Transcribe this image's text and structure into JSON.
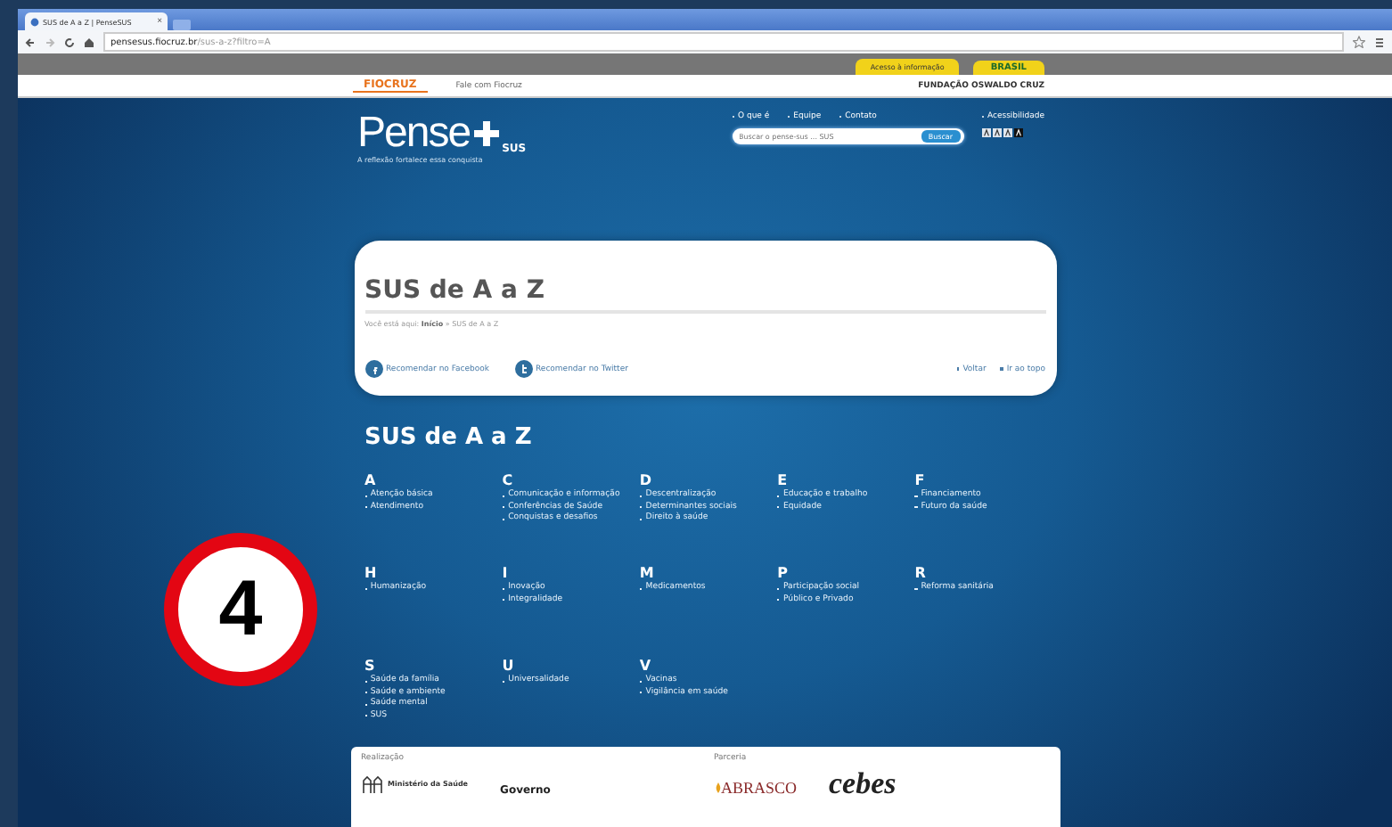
{
  "browser": {
    "tab_title": "SUS de A a Z | PenseSUS",
    "tab_close": "×",
    "url_host": "pensesus.fiocruz.br",
    "url_path": "/sus-a-z?filtro=A"
  },
  "gov_bar": {
    "links": [
      "Acesso à informação",
      "BRASIL"
    ]
  },
  "fiocruz_bar": {
    "logo": "FIOCRUZ",
    "link": "Fale com Fiocruz",
    "institution": "FUNDAÇÃO OSWALDO CRUZ"
  },
  "header": {
    "logo": "Pense",
    "logo_sub": "SUS",
    "tagline": "A reflexão fortalece essa conquista",
    "nav": [
      "O que é",
      "Equipe",
      "Contato"
    ],
    "search": {
      "placeholder": "Buscar o pense-sus ... SUS",
      "button": "Buscar"
    },
    "accessibility": "Acessibilidade"
  },
  "card": {
    "title": "SUS de A a Z",
    "breadcrumb": {
      "prefix": "Você está aqui:",
      "home": "Início",
      "current": "» SUS de A a Z"
    },
    "share": [
      {
        "kind": "facebook",
        "label": "Recomendar no Facebook"
      },
      {
        "kind": "twitter",
        "label": "Recomendar no Twitter"
      }
    ],
    "links": [
      "Voltar",
      "Ir ao topo"
    ]
  },
  "index": {
    "title": "SUS de A a Z",
    "groups": [
      {
        "letter": "A",
        "items": [
          "Atenção básica",
          "Atendimento"
        ]
      },
      {
        "letter": "C",
        "items": [
          "Comunicação e informação",
          "Conferências de Saúde",
          "Conquistas e desafios"
        ]
      },
      {
        "letter": "D",
        "items": [
          "Descentralização",
          "Determinantes sociais",
          "Direito à saúde"
        ]
      },
      {
        "letter": "E",
        "items": [
          "Educação e trabalho",
          "Equidade"
        ]
      },
      {
        "letter": "F",
        "items": [
          "Financiamento",
          "Futuro da saúde"
        ]
      },
      {
        "letter": "H",
        "items": [
          "Humanização"
        ]
      },
      {
        "letter": "I",
        "items": [
          "Inovação",
          "Integralidade"
        ]
      },
      {
        "letter": "M",
        "items": [
          "Medicamentos"
        ]
      },
      {
        "letter": "P",
        "items": [
          "Participação social",
          "Público e Privado"
        ]
      },
      {
        "letter": "R",
        "items": [
          "Reforma sanitária"
        ]
      },
      {
        "letter": "S",
        "items": [
          "Saúde da família",
          "Saúde e ambiente",
          "Saúde mental",
          "SUS"
        ]
      },
      {
        "letter": "U",
        "items": [
          "Universalidade"
        ]
      },
      {
        "letter": "V",
        "items": [
          "Vacinas",
          "Vigilância em saúde"
        ]
      }
    ]
  },
  "partners": {
    "sections": [
      {
        "label": "Realização",
        "logos": [
          "Ministério da Saúde",
          "Governo"
        ]
      },
      {
        "label": "Parceria",
        "logos": [
          "ABRASCO",
          "cebes"
        ]
      }
    ]
  },
  "step_badge": "4"
}
